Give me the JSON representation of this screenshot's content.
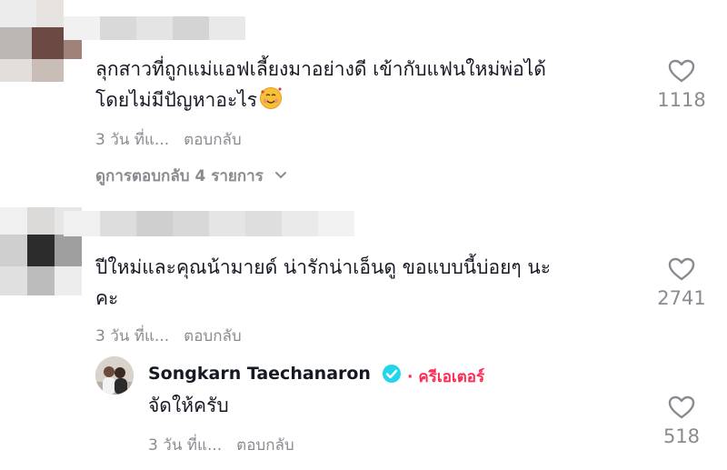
{
  "comments": [
    {
      "text_line1": "ลุกสาวที่ถูกแม่แอฟเลี้ยงมาอย่างดี เข้ากับแฟนใหม่พ่อได้",
      "text_line2": "โดยไม่มีปัญหาอะไร",
      "emoji": "smiling-face-with-hearts",
      "time": "3 วัน ที่แ...",
      "reply_label": "ตอบกลับ",
      "likes": "1118",
      "view_replies": "ดูการตอบกลับ 4 รายการ"
    },
    {
      "text_line1": "ปีใหม่และคุณน้ามายด์ น่ารักน่าเอ็นดู ขอแบบนี้บ่อยๆ นะ",
      "text_line2": "คะ",
      "time": "3 วัน ที่แ...",
      "reply_label": "ตอบกลับ",
      "likes": "2741"
    }
  ],
  "reply": {
    "username": "Songkarn Taechanaron",
    "creator_label": "ครีเอเตอร์",
    "text": "จัดให้ครับ",
    "time": "3 วัน ที่แ...",
    "reply_label": "ตอบกลับ",
    "likes": "518"
  },
  "colors": {
    "text": "#161823",
    "muted": "#8a8b91",
    "creator": "#fe2c55",
    "verified": "#20d5ec"
  },
  "icons": {
    "like": "heart-outline-icon",
    "expand": "chevron-down-icon",
    "verified": "verified-badge-icon"
  }
}
